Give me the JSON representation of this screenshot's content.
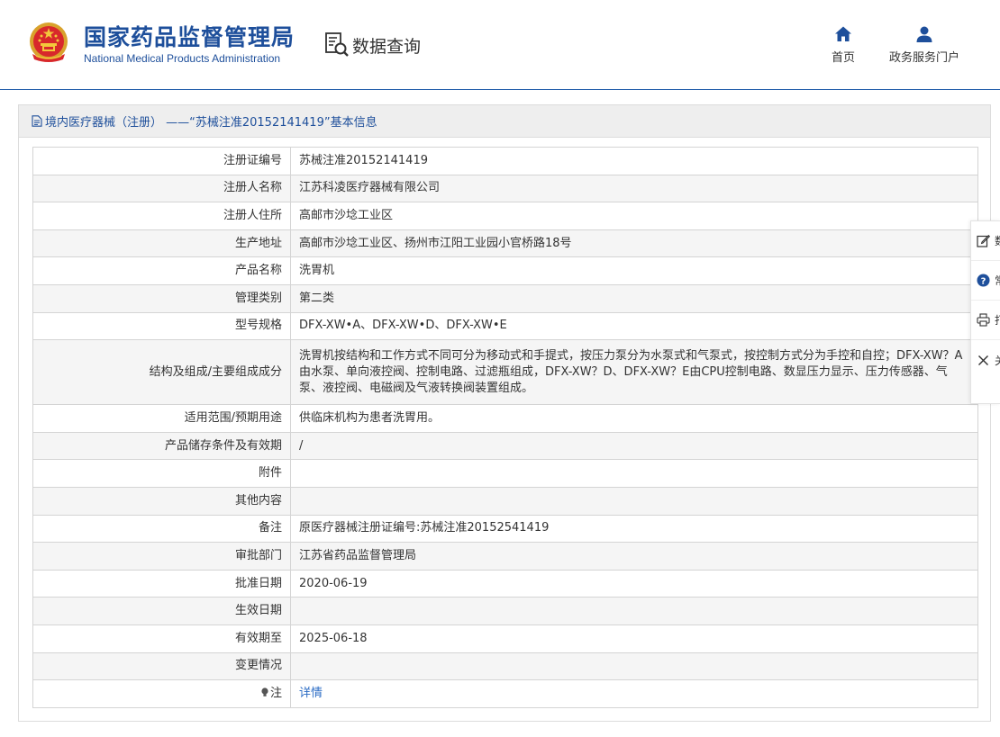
{
  "header": {
    "brand_cn": "国家药品监督管理局",
    "brand_en": "National Medical Products Administration",
    "data_query": "数据查询",
    "nav": {
      "home": "首页",
      "portal": "政务服务门户"
    }
  },
  "panel": {
    "title": "境内医疗器械（注册） ——“苏械注准20152141419”基本信息"
  },
  "rows": [
    {
      "label": "注册证编号",
      "value": "苏械注准20152141419"
    },
    {
      "label": "注册人名称",
      "value": "江苏科凌医疗器械有限公司"
    },
    {
      "label": "注册人住所",
      "value": "高邮市沙埝工业区"
    },
    {
      "label": "生产地址",
      "value": "高邮市沙埝工业区、扬州市江阳工业园小官桥路18号"
    },
    {
      "label": "产品名称",
      "value": "洗胃机"
    },
    {
      "label": "管理类别",
      "value": "第二类"
    },
    {
      "label": "型号规格",
      "value": "DFX-XW•A、DFX-XW•D、DFX-XW•E"
    },
    {
      "label": "结构及组成/主要组成成分",
      "value": "洗胃机按结构和工作方式不同可分为移动式和手提式，按压力泵分为水泵式和气泵式，按控制方式分为手控和自控；DFX-XW？A由水泵、单向液控阀、控制电路、过滤瓶组成，DFX-XW？D、DFX-XW？E由CPU控制电路、数显压力显示、压力传感器、气泵、液控阀、电磁阀及气液转换阀装置组成。"
    },
    {
      "label": "适用范围/预期用途",
      "value": "供临床机构为患者洗胃用。"
    },
    {
      "label": "产品储存条件及有效期",
      "value": "/"
    },
    {
      "label": "附件",
      "value": ""
    },
    {
      "label": "其他内容",
      "value": ""
    },
    {
      "label": "备注",
      "value": "原医疗器械注册证编号:苏械注准20152541419"
    },
    {
      "label": "审批部门",
      "value": "江苏省药品监督管理局"
    },
    {
      "label": "批准日期",
      "value": "2020-06-19"
    },
    {
      "label": "生效日期",
      "value": ""
    },
    {
      "label": "有效期至",
      "value": "2025-06-18"
    },
    {
      "label": "变更情况",
      "value": ""
    },
    {
      "label": "注",
      "value": "详情"
    }
  ],
  "side_bar": {
    "items": [
      "数",
      "常",
      "打",
      "关"
    ]
  },
  "colors": {
    "brand_blue": "#1e4f9b",
    "link_blue": "#2b6cc4",
    "header_line": "#1e5aa8"
  }
}
